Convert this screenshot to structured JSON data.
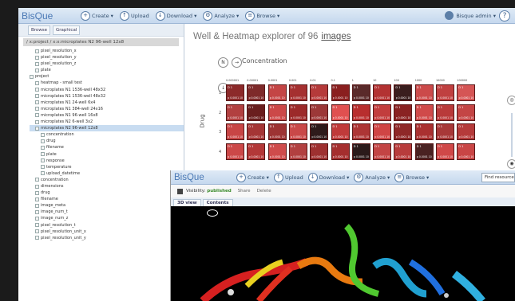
{
  "app": {
    "logo": "BisQue"
  },
  "nav": [
    {
      "icon": "plus-icon",
      "glyph": "+",
      "label": "Create ▾"
    },
    {
      "icon": "upload-icon",
      "glyph": "↑",
      "label": "Upload"
    },
    {
      "icon": "download-icon",
      "glyph": "↓",
      "label": "Download ▾"
    },
    {
      "icon": "analyze-icon",
      "glyph": "⚙",
      "label": "Analyze ▾"
    },
    {
      "icon": "browse-icon",
      "glyph": "≡",
      "label": "Browse ▾"
    }
  ],
  "user": {
    "label": "Bisque admin ▾"
  },
  "help": {
    "glyph": "?"
  },
  "sidebar": {
    "tabs": [
      "Browse",
      "Graphical"
    ],
    "crumb": "/ x:project / x:x:microplates N2 96-well 12x8"
  },
  "tree": [
    {
      "label": "pixel_resolution_x",
      "d": 1
    },
    {
      "label": "pixel_resolution_y",
      "d": 1
    },
    {
      "label": "pixel_resolution_z",
      "d": 1
    },
    {
      "label": "plate",
      "d": 1
    },
    {
      "label": "project",
      "d": 0
    },
    {
      "label": "heatmap - small test",
      "d": 1
    },
    {
      "label": "microplates N1 1536-well 48x32",
      "d": 1
    },
    {
      "label": "microplates N1 1536-well 48x32",
      "d": 1
    },
    {
      "label": "microplates N1 24-well 6x4",
      "d": 1
    },
    {
      "label": "microplates N1 384-well 24x16",
      "d": 1
    },
    {
      "label": "microplates N1 96-well 16x8",
      "d": 1
    },
    {
      "label": "microplates N2 6-well 3x2",
      "d": 1
    },
    {
      "label": "microplates N2 96-well 12x8",
      "d": 1,
      "sel": true
    },
    {
      "label": "concentration",
      "d": 2
    },
    {
      "label": "drug",
      "d": 2
    },
    {
      "label": "filename",
      "d": 2
    },
    {
      "label": "plate",
      "d": 2
    },
    {
      "label": "response",
      "d": 2
    },
    {
      "label": "temperature",
      "d": 2
    },
    {
      "label": "upload_datetime",
      "d": 2
    },
    {
      "label": "concentration",
      "d": 1
    },
    {
      "label": "dimensions",
      "d": 1
    },
    {
      "label": "drug",
      "d": 1
    },
    {
      "label": "filename",
      "d": 1
    },
    {
      "label": "image_meta",
      "d": 1
    },
    {
      "label": "image_num_t",
      "d": 1
    },
    {
      "label": "image_num_z",
      "d": 1
    },
    {
      "label": "pixel_resolution_t",
      "d": 1
    },
    {
      "label": "pixel_resolution_unit_x",
      "d": 1
    },
    {
      "label": "pixel_resolution_unit_y",
      "d": 1
    }
  ],
  "explorer": {
    "title": "Well & Heatmap explorer of 96",
    "link": "images",
    "concentration": "Concentration",
    "drug": "Drug",
    "toggle_label": "N",
    "arrow_right": "→",
    "arrow_down": "↓",
    "slider_top": "◎",
    "slider_bottom": "◉"
  },
  "grid": {
    "cols": [
      "0.000001",
      "0.00001",
      "0.0001",
      "0.001",
      "0.01",
      "0.1",
      "1",
      "10",
      "100",
      "1000",
      "10000",
      "100000"
    ],
    "rows": [
      "1",
      "2",
      "3",
      "4"
    ],
    "cells": [
      [
        {
          "t": "D 1",
          "v": "p 0.0001 10"
        },
        {
          "t": "D 1",
          "v": "p 0.0001 10"
        },
        {
          "t": "D 1",
          "v": "p 0.0001 10"
        },
        {
          "t": "D 1",
          "v": "p 0.0001 10"
        },
        {
          "t": "D 1",
          "v": "p 0.0001 10"
        },
        {
          "t": "D 1",
          "v": "p 0.0001 10"
        },
        {
          "t": "D 1",
          "v": "p 0.0001 10"
        },
        {
          "t": "D 1",
          "v": "p 0.0001 10"
        },
        {
          "t": "D 1",
          "v": "p 0.0001 10"
        },
        {
          "t": "D 1",
          "v": "p 0.0001 10"
        },
        {
          "t": "D 1",
          "v": "p 0.0001 10"
        },
        {
          "t": "D 1",
          "v": "p 0.0001 10"
        }
      ],
      [
        {
          "t": "D 1",
          "v": "p 0.0001 10"
        },
        {
          "t": "D 1",
          "v": "p 0.0001 10"
        },
        {
          "t": "D 1",
          "v": "p 0.0001 10"
        },
        {
          "t": "D 1",
          "v": "p 0.0001 10"
        },
        {
          "t": "D 1",
          "v": "p 0.0001 10"
        },
        {
          "t": "D 1",
          "v": "p 0.0001 10"
        },
        {
          "t": "D 1",
          "v": "p 0.0001 10"
        },
        {
          "t": "D 1",
          "v": "p 0.0001 10"
        },
        {
          "t": "D 1",
          "v": "p 0.0001 10"
        },
        {
          "t": "D 1",
          "v": "p 0.0001 10"
        },
        {
          "t": "D 1",
          "v": "p 0.0001 10"
        },
        {
          "t": "D 1",
          "v": "p 0.0001 10"
        }
      ],
      [
        {
          "t": "D 1",
          "v": "p 0.0001 10"
        },
        {
          "t": "D 1",
          "v": "p 0.0001 10"
        },
        {
          "t": "D 1",
          "v": "p 0.0001 10"
        },
        {
          "t": "D 1",
          "v": "p 0.0001 10"
        },
        {
          "t": "D 1",
          "v": "p 0.0001 10"
        },
        {
          "t": "D 1",
          "v": "p 0.0001 10"
        },
        {
          "t": "D 1",
          "v": "p 0.0001 10"
        },
        {
          "t": "D 1",
          "v": "p 0.0001 10"
        },
        {
          "t": "D 1",
          "v": "p 0.0001 10"
        },
        {
          "t": "D 1",
          "v": "p 0.0001 10"
        },
        {
          "t": "D 1",
          "v": "p 0.0001 10"
        },
        {
          "t": "D 1",
          "v": "p 0.0001 10"
        }
      ],
      [
        {
          "t": "D 1",
          "v": "p 0.0001 10"
        },
        {
          "t": "D 1",
          "v": "p 0.0001 10"
        },
        {
          "t": "D 1",
          "v": "p 0.0001 10"
        },
        {
          "t": "D 1",
          "v": "p 0.0001 10"
        },
        {
          "t": "D 1",
          "v": "p 0.0001 10"
        },
        {
          "t": "D 1",
          "v": "p 0.0001 10"
        },
        {
          "t": "D 1",
          "v": "p 0.0001 10"
        },
        {
          "t": "D 1",
          "v": "p 0.0001 10"
        },
        {
          "t": "D 1",
          "v": "p 0.0001 10"
        },
        {
          "t": "D 1",
          "v": "p 0.0001 10"
        },
        {
          "t": "D 1",
          "v": "p 0.0001 10"
        },
        {
          "t": "D 1",
          "v": "p 0.0001 10"
        }
      ]
    ],
    "colors": [
      [
        "#8c2a2a",
        "#7e2a2a",
        "#c44545",
        "#a53030",
        "#b53a3a",
        "#8a1f1f",
        "#5a2a2a",
        "#b33232",
        "#3a1e1e",
        "#cc4a4a",
        "#c04040",
        "#d55555"
      ],
      [
        "#b24040",
        "#6a1e1e",
        "#cc4848",
        "#9c2a2a",
        "#9c3838",
        "#e05050",
        "#b82e2e",
        "#c23d3d",
        "#8a2222",
        "#d04a4a",
        "#b93a3a",
        "#c44545"
      ],
      [
        "#c84545",
        "#a53535",
        "#9d3333",
        "#c94848",
        "#2e1a1a",
        "#c03a3a",
        "#ad3535",
        "#d04545",
        "#8f2828",
        "#aa3030",
        "#a83838",
        "#b53a3a"
      ],
      [
        "#cc4848",
        "#b33838",
        "#cf4b4b",
        "#b24040",
        "#9e3030",
        "#a52e2e",
        "#2b1a1a",
        "#c34444",
        "#b83c3c",
        "#4a2222",
        "#d04848",
        "#c94545"
      ]
    ]
  },
  "overlay": {
    "logo": "BisQue",
    "nav": [
      {
        "icon": "plus-icon",
        "glyph": "+",
        "label": "Create ▾"
      },
      {
        "icon": "upload-icon",
        "glyph": "↑",
        "label": "Upload"
      },
      {
        "icon": "download-icon",
        "glyph": "↓",
        "label": "Download ▾"
      },
      {
        "icon": "analyze-icon",
        "glyph": "⚙",
        "label": "Analyze ▾"
      },
      {
        "icon": "browse-icon",
        "glyph": "≡",
        "label": "Browse ▾"
      }
    ],
    "find": "Find resource",
    "visibility_label": "Visibility:",
    "visibility_value": "published",
    "share": "Share",
    "delete": "Delete",
    "tabs": [
      "3D view",
      "Contents"
    ]
  }
}
